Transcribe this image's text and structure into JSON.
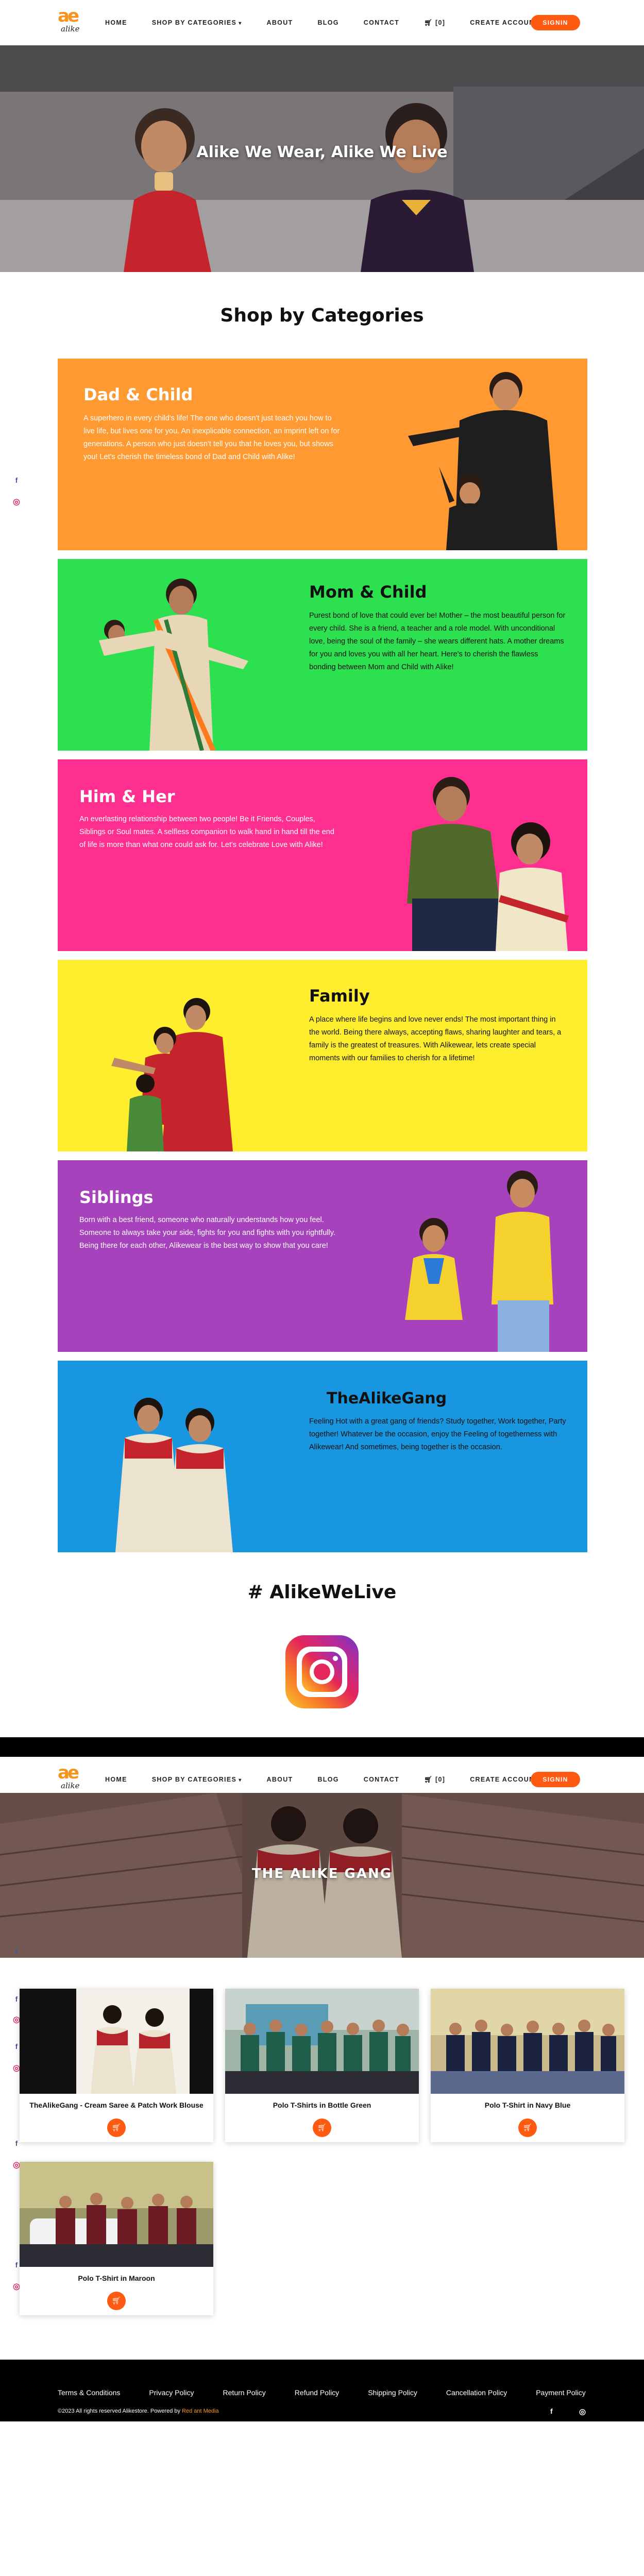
{
  "brand": {
    "logo_mark": "ae",
    "logo_word": "alike"
  },
  "nav": {
    "items": [
      {
        "label": "HOME"
      },
      {
        "label": "SHOP BY CATEGORIES"
      },
      {
        "label": "ABOUT"
      },
      {
        "label": "BLOG"
      },
      {
        "label": "CONTACT"
      },
      {
        "label": "[0]"
      },
      {
        "label": "CREATE ACCOUNT"
      }
    ],
    "signin": "SIGNIN"
  },
  "hero": {
    "title": "Alike We Wear, Alike We Live"
  },
  "categories": {
    "title": "Shop by Categories",
    "cards": [
      {
        "title": "Dad & Child",
        "color": "#ff9a33",
        "text": "A superhero in every child's life! The one who doesn't just teach you how to live life, but lives one for you. An inexplicable connection, an imprint left on for generations. A person who just doesn't tell you that he loves you, but shows you! Let's cherish the timeless bond of Dad and Child with Alike!"
      },
      {
        "title": "Mom & Child",
        "color": "#2de050",
        "text": "Purest bond of love that could ever be! Mother – the most beautiful person for every child. She is a friend, a teacher and a role model. With unconditional love, being the soul of the family – she wears different hats. A mother dreams for you and loves you with all her heart. Here's to cherish the flawless bonding between Mom and Child with Alike!"
      },
      {
        "title": "Him & Her",
        "color": "#ff2f8f",
        "text": "An everlasting relationship between two people! Be it Friends, Couples, Siblings or Soul mates. A selfless companion to walk hand in hand till the end of life is more than what one could ask for. Let's celebrate Love with Alike!"
      },
      {
        "title": "Family",
        "color": "#ffee2e",
        "text": "A place where life begins and love never ends! The most important thing in the world. Being there always, accepting flaws, sharing laughter and tears, a family is the greatest of treasures. With Alikewear, lets create special moments with our families to cherish for a lifetime!"
      },
      {
        "title": "Siblings",
        "color": "#a742bd",
        "text": "Born with a best friend, someone who naturally understands how you feel. Someone to always take your side, fights for you and fights with you rightfully. Being there for each other, Alikewear is the best way to show that you care!"
      },
      {
        "title": "TheAlikeGang",
        "color": "#1996e0",
        "text": "Feeling Hot with a great gang of friends? Study together, Work together, Party together! Whatever be the occasion, enjoy the Feeling of togetherness with Alikewear! And sometimes, being together is the occasion."
      }
    ]
  },
  "instagram": {
    "hashtag": "# AlikeWeLive",
    "icon": "instagram-icon"
  },
  "gang_page": {
    "hero_title": "THE ALIKE GANG",
    "products": [
      {
        "name": "TheAlikeGang - Cream Saree & Patch Work Blouse"
      },
      {
        "name": "Polo T-Shirts in Bottle Green"
      },
      {
        "name": "Polo T-Shirt in Navy Blue"
      },
      {
        "name": "Polo T-Shirt in Maroon"
      }
    ]
  },
  "footer": {
    "links": [
      {
        "label": "Terms & Conditions"
      },
      {
        "label": "Privacy Policy"
      },
      {
        "label": "Return Policy"
      },
      {
        "label": "Refund Policy"
      },
      {
        "label": "Shipping Policy"
      },
      {
        "label": "Cancellation Policy"
      },
      {
        "label": "Payment Policy"
      }
    ],
    "copyright": "©2023 All rights reserved Alikestore. Powered by ",
    "powered_by": "Red ant Media"
  },
  "colors": {
    "accent": "#ff5a12",
    "footer_bg": "#000000"
  }
}
